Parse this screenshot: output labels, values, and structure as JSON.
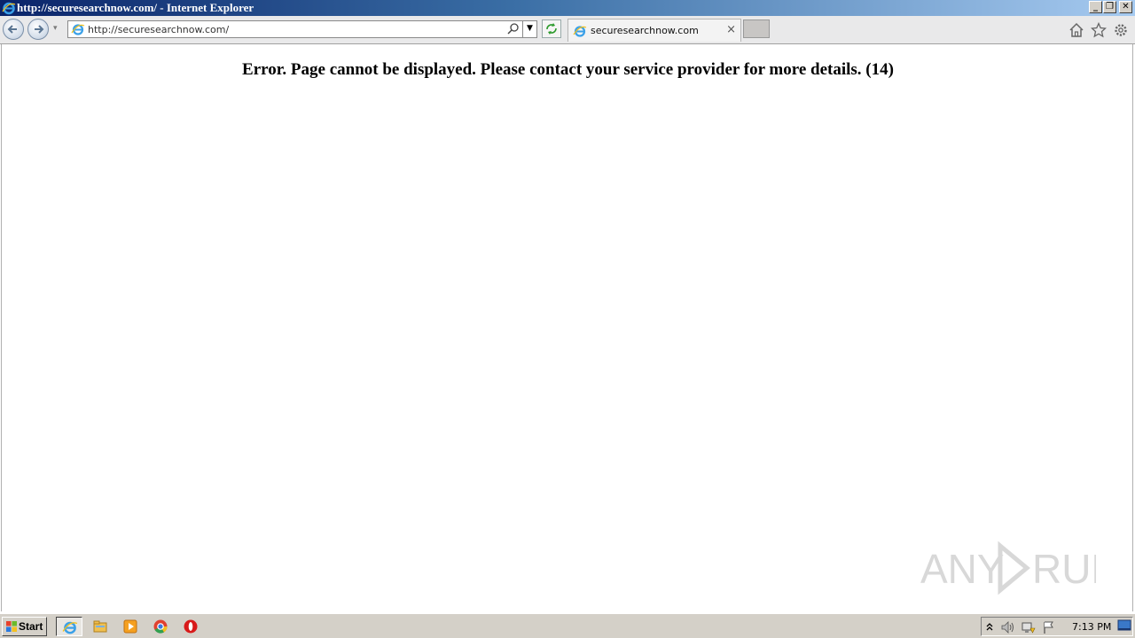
{
  "window": {
    "title": "http://securesearchnow.com/ - Internet Explorer",
    "minimize_glyph": "_",
    "restore_glyph": "❐",
    "close_glyph": "✕"
  },
  "navbar": {
    "address_url": "http://securesearchnow.com/",
    "dropdown_glyph": "▼",
    "history_glyph": "▾"
  },
  "tabs": [
    {
      "label": "securesearchnow.com",
      "close_glyph": "×"
    }
  ],
  "page": {
    "error_message": "Error. Page cannot be displayed. Please contact your service provider for more details. (14)"
  },
  "watermark": {
    "text": "ANY RUN"
  },
  "taskbar": {
    "start_label": "Start",
    "clock": "7:13 PM",
    "apps": [
      "ie-icon",
      "explorer-icon",
      "media-player-icon",
      "chrome-icon",
      "opera-icon"
    ],
    "tray_icons": [
      "tray-expand-icon",
      "volume-icon",
      "network-icon",
      "action-center-flag-icon"
    ]
  },
  "colors": {
    "titlebar_start": "#0a246a",
    "titlebar_end": "#a6caf0",
    "taskbar": "#d4d0c8"
  }
}
